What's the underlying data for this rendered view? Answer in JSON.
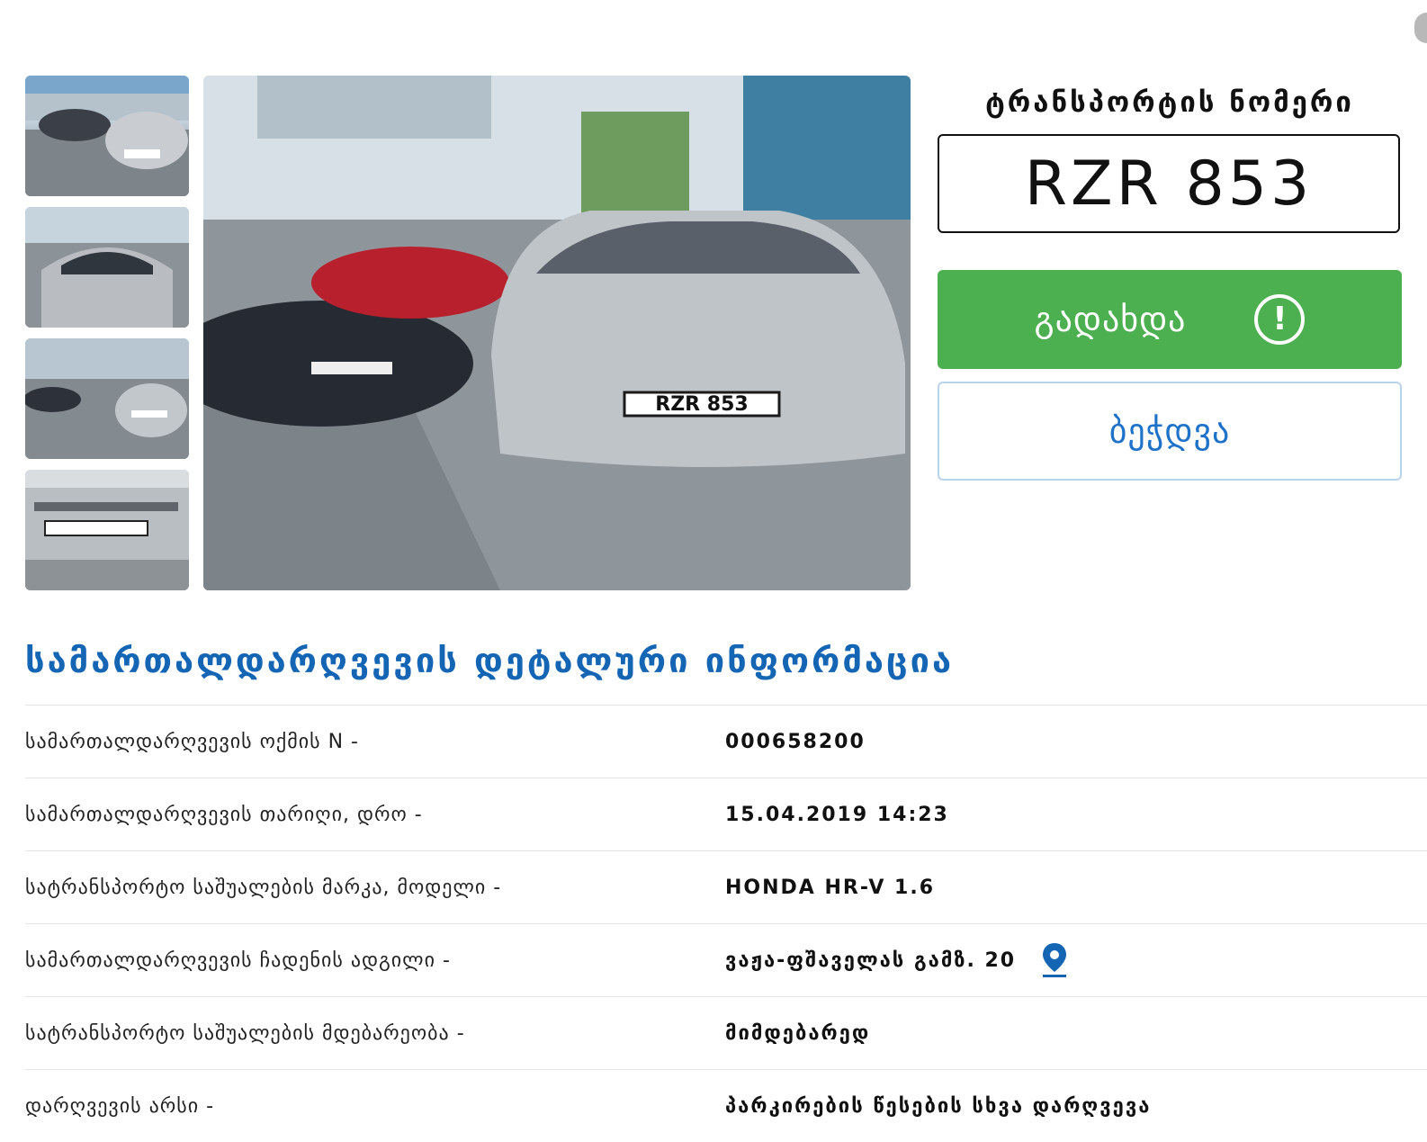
{
  "plate": {
    "label": "ტრანსპორტის ნომერი",
    "number": "RZR 853"
  },
  "actions": {
    "pay_label": "გადახდა",
    "print_label": "ბეჭდვა"
  },
  "photos": {
    "thumbnail_count": 4,
    "visible_plate_text": "RZR 853"
  },
  "details": {
    "title": "სამართალდარღვევის დეტალური ინფორმაცია",
    "rows": [
      {
        "key": "სამართალდარღვევის ოქმის N -",
        "value": "000658200"
      },
      {
        "key": "სამართალდარღვევის თარიღი, დრო -",
        "value": "15.04.2019 14:23"
      },
      {
        "key": "სატრანსპორტო საშუალების მარკა, მოდელი -",
        "value": "HONDA HR-V 1.6"
      },
      {
        "key": "სამართალდარღვევის ჩადენის ადგილი -",
        "value": "ვაჟა-ფშაველას გამზ. 20"
      },
      {
        "key": "სატრანსპორტო საშუალების მდებარეობა -",
        "value": "მიმდებარედ"
      },
      {
        "key": "დარღვევის არსი -",
        "value": "პარკირების წესების სხვა დარღვევა"
      }
    ]
  },
  "colors": {
    "accent_blue": "#1565b5",
    "pay_green": "#4caf50",
    "print_text": "#1e73c8"
  }
}
